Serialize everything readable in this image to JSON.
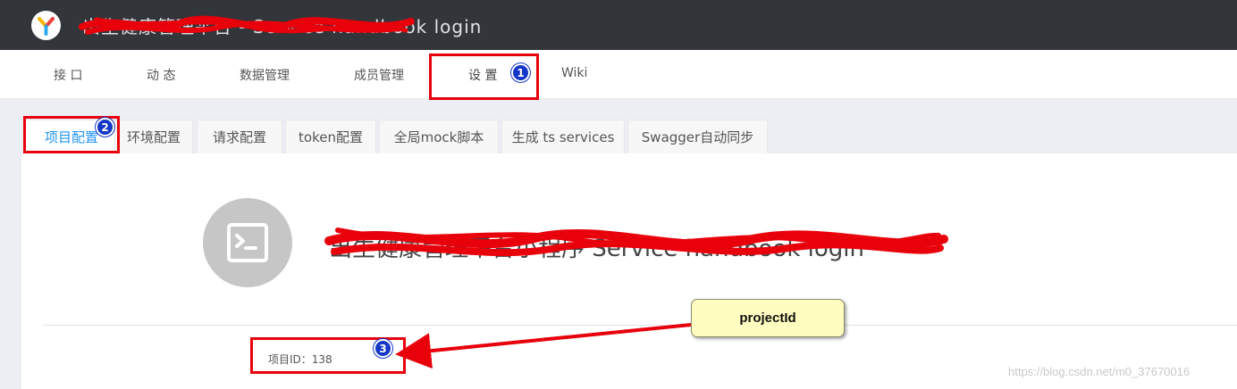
{
  "header": {
    "app_title": "出生健康管理平台 - Service handbook login",
    "logo_icon": "yapi-logo-icon"
  },
  "nav": {
    "items": [
      {
        "label": "接 口"
      },
      {
        "label": "动 态"
      },
      {
        "label": "数据管理"
      },
      {
        "label": "成员管理"
      },
      {
        "label": "设 置"
      },
      {
        "label": "Wiki"
      }
    ]
  },
  "settings_tabs": [
    {
      "label": "项目配置",
      "active": true
    },
    {
      "label": "环境配置"
    },
    {
      "label": "请求配置"
    },
    {
      "label": "token配置"
    },
    {
      "label": "全局mock脚本"
    },
    {
      "label": "生成 ts services"
    },
    {
      "label": "Swagger自动同步"
    }
  ],
  "project": {
    "icon": "terminal-icon",
    "name": "出生健康管理平台小程序 Service handbook login",
    "id_label": "项目ID：138"
  },
  "annotations": {
    "badges": [
      "1",
      "2",
      "3"
    ],
    "callout": "projectId",
    "color": "#e8000b",
    "badge_color": "#1537c8"
  },
  "watermark": "https://blog.csdn.net/m0_37670016",
  "colors": {
    "topbar": "#32363a",
    "accent": "#2395f1",
    "avatar": "#c6c6c6"
  }
}
